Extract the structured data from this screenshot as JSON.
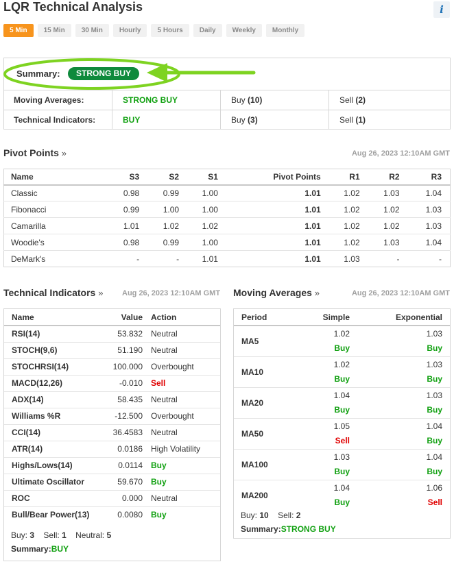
{
  "header": {
    "title": "LQR Technical Analysis",
    "info_icon": "info-icon",
    "info_glyph": "i"
  },
  "timeframes": [
    "5 Min",
    "15 Min",
    "30 Min",
    "Hourly",
    "5 Hours",
    "Daily",
    "Weekly",
    "Monthly"
  ],
  "active_timeframe": "5 Min",
  "colors": {
    "accent": "#f7941d",
    "buy": "#12a112",
    "sell": "#e00000",
    "badge": "#0f8a3c",
    "highlight": "#7ed321"
  },
  "summary": {
    "label": "Summary:",
    "value": "STRONG BUY",
    "rows": [
      {
        "name": "Moving Averages:",
        "signal": "STRONG BUY",
        "buy_label": "Buy",
        "buy_count": "(10)",
        "sell_label": "Sell",
        "sell_count": "(2)"
      },
      {
        "name": "Technical Indicators:",
        "signal": "BUY",
        "buy_label": "Buy",
        "buy_count": "(3)",
        "sell_label": "Sell",
        "sell_count": "(1)"
      }
    ]
  },
  "pivot": {
    "title": "Pivot Points",
    "arrow": "»",
    "timestamp": "Aug 26, 2023 12:10AM GMT",
    "columns": [
      "Name",
      "S3",
      "S2",
      "S1",
      "Pivot Points",
      "R1",
      "R2",
      "R3"
    ],
    "rows": [
      [
        "Classic",
        "0.98",
        "0.99",
        "1.00",
        "1.01",
        "1.02",
        "1.03",
        "1.04"
      ],
      [
        "Fibonacci",
        "0.99",
        "1.00",
        "1.00",
        "1.01",
        "1.02",
        "1.02",
        "1.03"
      ],
      [
        "Camarilla",
        "1.01",
        "1.02",
        "1.02",
        "1.01",
        "1.02",
        "1.02",
        "1.03"
      ],
      [
        "Woodie's",
        "0.98",
        "0.99",
        "1.00",
        "1.01",
        "1.02",
        "1.03",
        "1.04"
      ],
      [
        "DeMark's",
        "-",
        "-",
        "1.01",
        "1.01",
        "1.03",
        "-",
        "-"
      ]
    ]
  },
  "technical": {
    "title": "Technical Indicators",
    "arrow": "»",
    "timestamp": "Aug 26, 2023 12:10AM GMT",
    "columns": [
      "Name",
      "Value",
      "Action"
    ],
    "rows": [
      {
        "name": "RSI(14)",
        "value": "53.832",
        "action": "Neutral",
        "kind": "neutral"
      },
      {
        "name": "STOCH(9,6)",
        "value": "51.190",
        "action": "Neutral",
        "kind": "neutral"
      },
      {
        "name": "STOCHRSI(14)",
        "value": "100.000",
        "action": "Overbought",
        "kind": "neutral"
      },
      {
        "name": "MACD(12,26)",
        "value": "-0.010",
        "action": "Sell",
        "kind": "sell"
      },
      {
        "name": "ADX(14)",
        "value": "58.435",
        "action": "Neutral",
        "kind": "neutral"
      },
      {
        "name": "Williams %R",
        "value": "-12.500",
        "action": "Overbought",
        "kind": "neutral"
      },
      {
        "name": "CCI(14)",
        "value": "36.4583",
        "action": "Neutral",
        "kind": "neutral"
      },
      {
        "name": "ATR(14)",
        "value": "0.0186",
        "action": "High Volatility",
        "kind": "neutral"
      },
      {
        "name": "Highs/Lows(14)",
        "value": "0.0114",
        "action": "Buy",
        "kind": "buy"
      },
      {
        "name": "Ultimate Oscillator",
        "value": "59.670",
        "action": "Buy",
        "kind": "buy"
      },
      {
        "name": "ROC",
        "value": "0.000",
        "action": "Neutral",
        "kind": "neutral"
      },
      {
        "name": "Bull/Bear Power(13)",
        "value": "0.0080",
        "action": "Buy",
        "kind": "buy"
      }
    ],
    "footer": {
      "buy_label": "Buy:",
      "buy": "3",
      "sell_label": "Sell:",
      "sell": "1",
      "neutral_label": "Neutral:",
      "neutral": "5",
      "summary_label": "Summary:",
      "summary": "BUY"
    }
  },
  "moving": {
    "title": "Moving Averages",
    "arrow": "»",
    "timestamp": "Aug 26, 2023 12:10AM GMT",
    "columns": [
      "Period",
      "Simple",
      "Exponential"
    ],
    "rows": [
      {
        "period": "MA5",
        "simple": "1.02",
        "simple_action": "Buy",
        "exp": "1.03",
        "exp_action": "Buy"
      },
      {
        "period": "MA10",
        "simple": "1.02",
        "simple_action": "Buy",
        "exp": "1.03",
        "exp_action": "Buy"
      },
      {
        "period": "MA20",
        "simple": "1.04",
        "simple_action": "Buy",
        "exp": "1.03",
        "exp_action": "Buy"
      },
      {
        "period": "MA50",
        "simple": "1.05",
        "simple_action": "Sell",
        "exp": "1.04",
        "exp_action": "Buy"
      },
      {
        "period": "MA100",
        "simple": "1.03",
        "simple_action": "Buy",
        "exp": "1.04",
        "exp_action": "Buy"
      },
      {
        "period": "MA200",
        "simple": "1.04",
        "simple_action": "Buy",
        "exp": "1.06",
        "exp_action": "Sell"
      }
    ],
    "footer": {
      "buy_label": "Buy:",
      "buy": "10",
      "sell_label": "Sell:",
      "sell": "2",
      "summary_label": "Summary:",
      "summary": "STRONG BUY"
    }
  }
}
